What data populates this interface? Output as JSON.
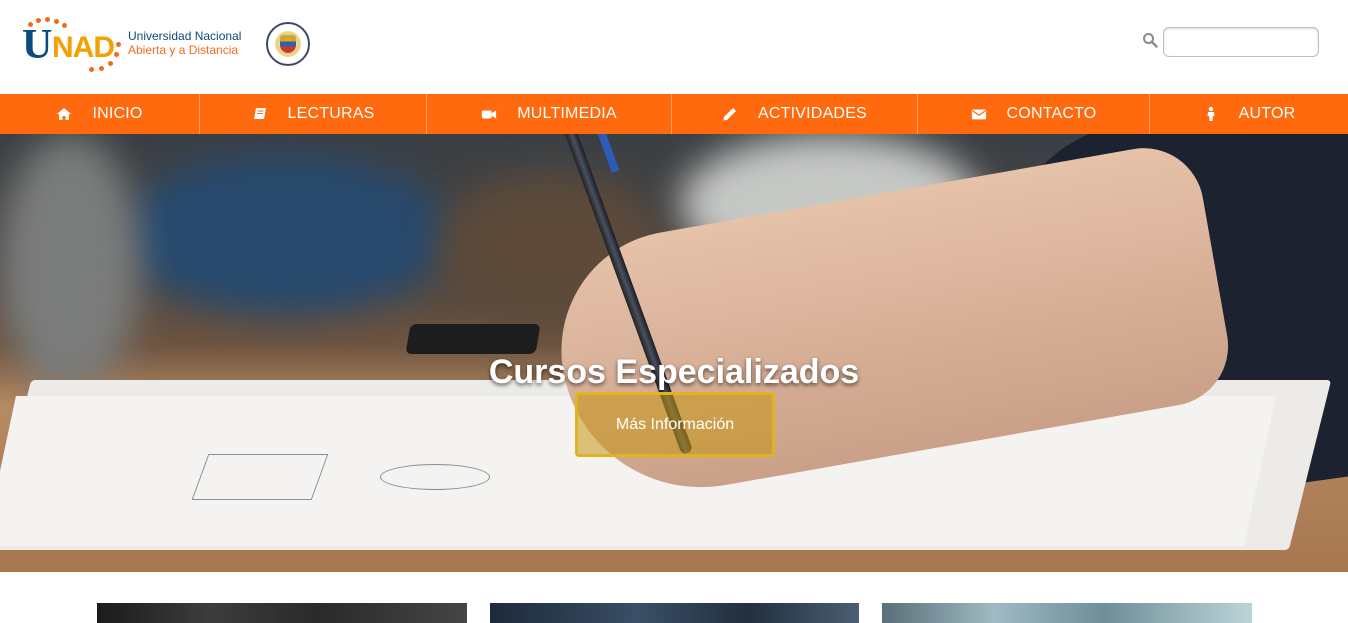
{
  "header": {
    "logo": {
      "mark_u": "U",
      "mark_nad": "NAD",
      "line1": "Universidad Nacional",
      "line2": "Abierta y a Distancia"
    },
    "search": {
      "placeholder": "",
      "value": ""
    }
  },
  "nav": {
    "items": [
      {
        "label": "INICIO",
        "icon": "home-icon"
      },
      {
        "label": "LECTURAS",
        "icon": "book-icon"
      },
      {
        "label": "MULTIMEDIA",
        "icon": "video-camera-icon"
      },
      {
        "label": "ACTIVIDADES",
        "icon": "pencil-icon"
      },
      {
        "label": "CONTACTO",
        "icon": "envelope-icon"
      },
      {
        "label": "AUTOR",
        "icon": "person-icon"
      }
    ]
  },
  "hero": {
    "title": "Cursos Especializados",
    "button_label": "Más Información"
  },
  "colors": {
    "brand_orange": "#ff6a0f",
    "brand_blue": "#0b4a7e",
    "brand_yellow": "#f5a000",
    "button_border": "#e0b421"
  }
}
